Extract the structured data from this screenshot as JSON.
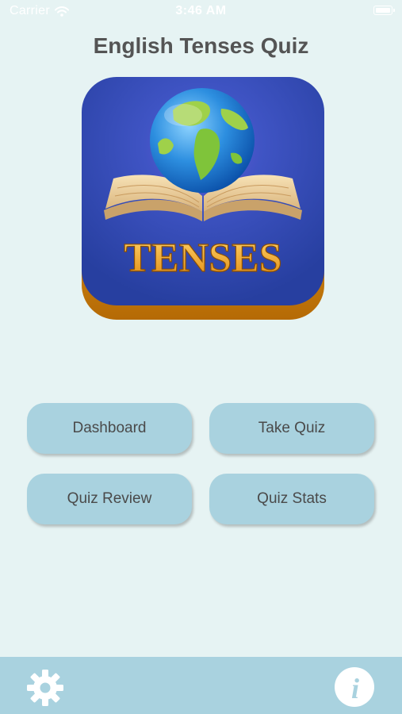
{
  "status_bar": {
    "carrier": "Carrier",
    "time": "3:46 AM"
  },
  "app": {
    "title": "English Tenses Quiz"
  },
  "logo": {
    "text": "TENSES",
    "icon": "globe-on-book-icon"
  },
  "buttons": {
    "dashboard": "Dashboard",
    "take_quiz": "Take Quiz",
    "quiz_review": "Quiz Review",
    "quiz_stats": "Quiz Stats"
  },
  "toolbar": {
    "settings_icon": "gear-icon",
    "info_icon": "info-icon"
  },
  "colors": {
    "background": "#e6f3f3",
    "button": "#a9d2df",
    "title": "#545454",
    "logo_blue": "#2f4fb0",
    "logo_gold": "#e8a010"
  }
}
